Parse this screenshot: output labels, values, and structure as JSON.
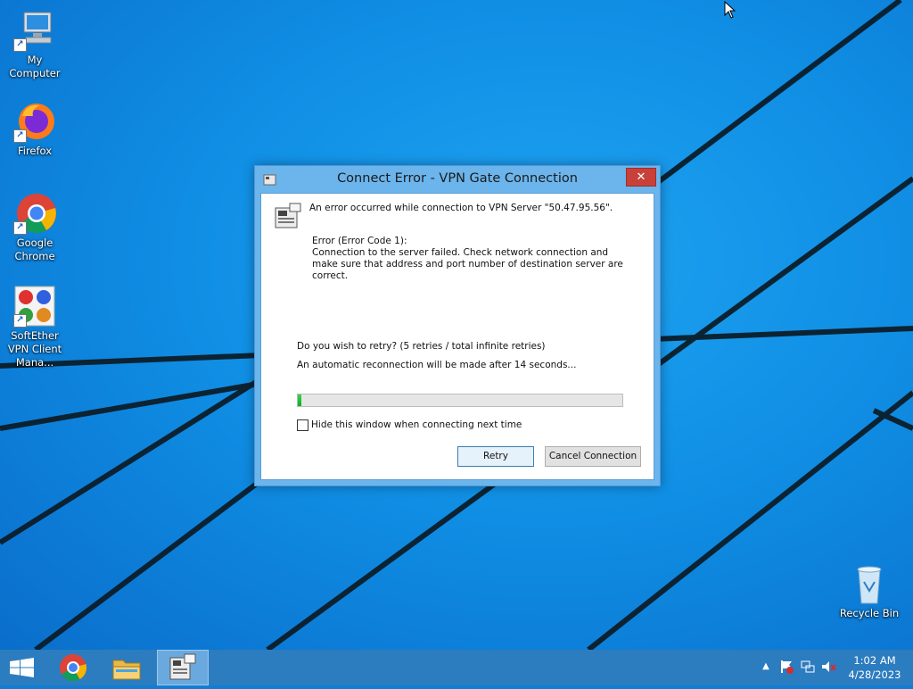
{
  "desktop": {
    "icons": [
      {
        "label": "My Computer",
        "icon": "computer-icon"
      },
      {
        "label": "Firefox",
        "icon": "firefox-icon"
      },
      {
        "label": "Google Chrome",
        "icon": "chrome-icon"
      },
      {
        "label": "SoftEther VPN Client Mana...",
        "icon": "softether-vpn-icon"
      },
      {
        "label": "Recycle Bin",
        "icon": "recycle-bin-icon"
      }
    ]
  },
  "dialog": {
    "title": "Connect Error - VPN Gate Connection",
    "close_label": "✕",
    "message": "An error occurred while connection to VPN Server \"50.47.95.56\".",
    "error_heading": "Error (Error Code 1):",
    "error_body_1": "Connection to the server failed. Check network connection and",
    "error_body_2": "make sure that address and port number of destination server are",
    "error_body_3": "correct.",
    "retry_question": "Do you wish to retry? (5 retries / total infinite retries)",
    "auto_reconnect": "An automatic reconnection will be made after 14 seconds...",
    "progress_fraction": 0.01,
    "hide_checkbox_label": "Hide this window when connecting next time",
    "hide_checked": false,
    "retry_button": "Retry",
    "cancel_button": "Cancel Connection"
  },
  "taskbar": {
    "apps": [
      "start-icon",
      "chrome-icon",
      "file-explorer-icon",
      "softether-vpn-icon"
    ],
    "tray_icons": [
      "show-hidden-icons-chevron",
      "action-center-flag-icon",
      "network-icon",
      "volume-muted-icon"
    ],
    "time": "1:02 AM",
    "date": "4/28/2023"
  },
  "colors": {
    "desktop_blue": "#108fe5",
    "dialog_frame": "#6bb4ec",
    "close_red": "#c7413a",
    "progress_green": "#06b025",
    "taskbar": "#2c7cc0"
  }
}
